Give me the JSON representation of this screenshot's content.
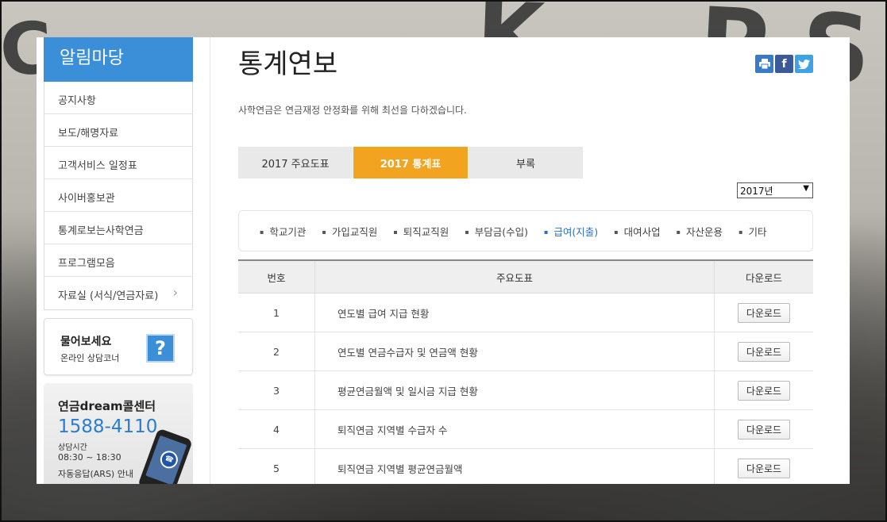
{
  "sidebar": {
    "title": "알림마당",
    "items": [
      {
        "label": "공지사항"
      },
      {
        "label": "보도/해명자료"
      },
      {
        "label": "고객서비스 일정표"
      },
      {
        "label": "사이버홍보관"
      },
      {
        "label": "통계로보는사학연금"
      },
      {
        "label": "프로그램모음"
      },
      {
        "label": "자료실 (서식/연금자료)",
        "chevron": "›"
      }
    ],
    "ask": {
      "title": "물어보세요",
      "subtitle": "온라인 상담코너",
      "icon": "?"
    },
    "callcenter": {
      "title": "연금dream콜센터",
      "number": "1588-4110",
      "hours_label": "상담시간",
      "hours": "08:30 ~ 18:30",
      "ars": "자동응답(ARS) 안내"
    }
  },
  "main": {
    "title": "통계연보",
    "intro": "사학연금은 연금재정 안정화를 위해 최선을 다하겠습니다.",
    "tabs": [
      {
        "label": "2017 주요도표",
        "active": false
      },
      {
        "label": "2017 통계표",
        "active": true
      },
      {
        "label": "부록",
        "active": false
      }
    ],
    "year_select": {
      "value": "2017년"
    },
    "categories": [
      {
        "label": "학교기관",
        "active": false
      },
      {
        "label": "가입교직원",
        "active": false
      },
      {
        "label": "퇴직교직원",
        "active": false
      },
      {
        "label": "부담금(수입)",
        "active": false
      },
      {
        "label": "급여(지출)",
        "active": true
      },
      {
        "label": "대여사업",
        "active": false
      },
      {
        "label": "자산운용",
        "active": false
      },
      {
        "label": "기타",
        "active": false
      }
    ],
    "table": {
      "headers": [
        "번호",
        "주요도표",
        "다운로드"
      ],
      "download_label": "다운로드",
      "rows": [
        {
          "num": "1",
          "title": "연도별 급여 지급 현황"
        },
        {
          "num": "2",
          "title": "연도별 연금수급자 및 연금액 현황"
        },
        {
          "num": "3",
          "title": "평균연금월액 및 일시금 지급 현황"
        },
        {
          "num": "4",
          "title": "퇴직연금 지역별 수급자 수"
        },
        {
          "num": "5",
          "title": "퇴직연금 지역별 평균연금월액"
        }
      ]
    }
  },
  "colors": {
    "accent_blue": "#3a8fd8",
    "active_tab": "#f2a31f",
    "link_active": "#2a6fc0"
  }
}
